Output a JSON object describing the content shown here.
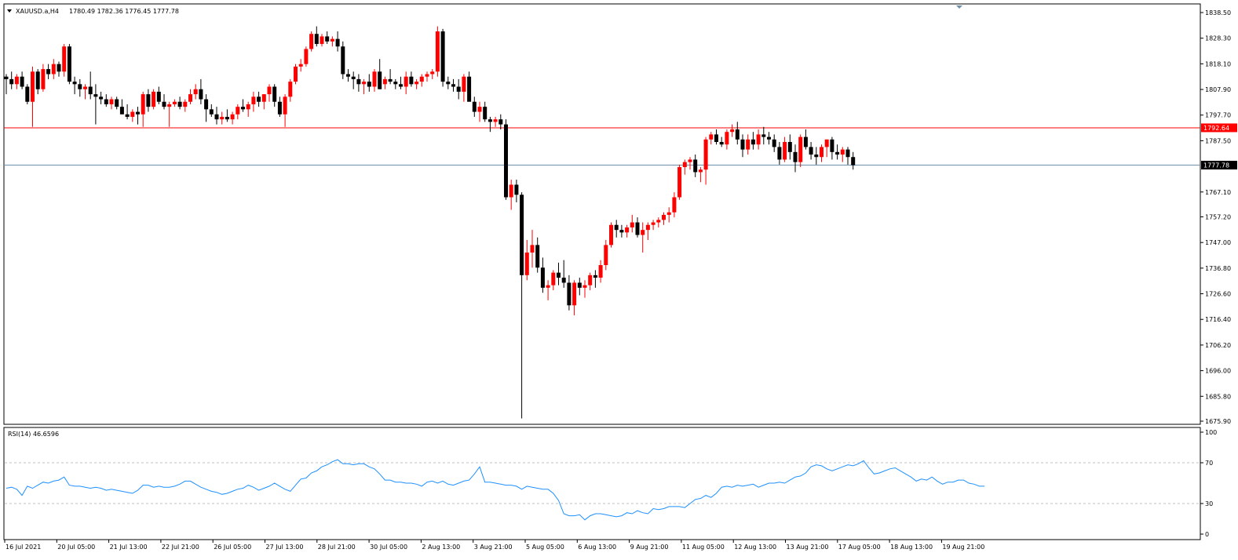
{
  "header": {
    "symbol": "XAUUSD.a,H4",
    "ohlc": "1780.49 1782.36 1776.45 1777.78"
  },
  "rsi_header": "RSI(14) 46.6596",
  "colors": {
    "bull": "#ff0000",
    "bear": "#000000",
    "rsi_line": "#1e90ff",
    "level_line": "#ff0000",
    "price_line": "#6f8fa8",
    "grid_dash": "#c0c0c0"
  },
  "price_axis": {
    "ticks": [
      "1838.50",
      "1828.30",
      "1818.10",
      "1807.90",
      "1797.70",
      "1787.50",
      "1767.10",
      "1757.20",
      "1747.00",
      "1736.80",
      "1726.60",
      "1716.40",
      "1706.20",
      "1696.00",
      "1685.80",
      "1675.90"
    ],
    "level_label": "1792.64",
    "current_label": "1777.78"
  },
  "rsi_axis": {
    "ticks": [
      "100",
      "70",
      "30",
      "0"
    ]
  },
  "time_axis": {
    "ticks": [
      "16 Jul 2021",
      "20 Jul 05:00",
      "21 Jul 13:00",
      "22 Jul 21:00",
      "26 Jul 05:00",
      "27 Jul 13:00",
      "28 Jul 21:00",
      "30 Jul 05:00",
      "2 Aug 13:00",
      "3 Aug 21:00",
      "5 Aug 05:00",
      "6 Aug 13:00",
      "9 Aug 21:00",
      "11 Aug 05:00",
      "12 Aug 13:00",
      "13 Aug 21:00",
      "17 Aug 05:00",
      "18 Aug 13:00",
      "19 Aug 21:00"
    ]
  },
  "chart_data": [
    {
      "type": "candlestick",
      "title": "XAUUSD.a,H4",
      "ylim": [
        1675.9,
        1838.5
      ],
      "levels": {
        "horizontal_line": 1792.64,
        "last_price": 1777.78
      },
      "candles": [
        [
          1813.0,
          1814.0,
          1806.0,
          1812.0
        ],
        [
          1812.0,
          1815.0,
          1808.0,
          1810.0
        ],
        [
          1810.0,
          1814.0,
          1808.0,
          1813.0
        ],
        [
          1813.0,
          1815.0,
          1808.0,
          1809.0
        ],
        [
          1809.0,
          1810.0,
          1802.0,
          1803.0
        ],
        [
          1803.0,
          1817.0,
          1793.0,
          1815.0
        ],
        [
          1815.0,
          1816.0,
          1806.0,
          1808.0
        ],
        [
          1808.0,
          1818.0,
          1807.0,
          1816.0
        ],
        [
          1816.0,
          1818.0,
          1812.0,
          1814.0
        ],
        [
          1814.0,
          1820.0,
          1812.0,
          1818.0
        ],
        [
          1818.0,
          1819.0,
          1813.0,
          1815.0
        ],
        [
          1815.0,
          1826.0,
          1813.0,
          1825.0
        ],
        [
          1825.0,
          1826.0,
          1810.0,
          1811.0
        ],
        [
          1811.0,
          1813.0,
          1806.0,
          1810.0
        ],
        [
          1810.0,
          1812.0,
          1805.0,
          1808.0
        ],
        [
          1808.0,
          1810.0,
          1804.0,
          1809.0
        ],
        [
          1809.0,
          1815.0,
          1804.0,
          1806.0
        ],
        [
          1806.0,
          1810.0,
          1794.0,
          1805.0
        ],
        [
          1805.0,
          1807.0,
          1802.0,
          1804.0
        ],
        [
          1804.0,
          1806.0,
          1801.0,
          1802.0
        ],
        [
          1802.0,
          1805.0,
          1800.0,
          1804.0
        ],
        [
          1804.0,
          1805.0,
          1800.0,
          1801.0
        ],
        [
          1801.0,
          1804.0,
          1800.0,
          1798.0
        ],
        [
          1798.0,
          1802.0,
          1796.0,
          1797.0
        ],
        [
          1797.0,
          1800.0,
          1795.0,
          1799.0
        ],
        [
          1799.0,
          1801.0,
          1794.0,
          1798.0
        ],
        [
          1798.0,
          1807.0,
          1793.0,
          1806.0
        ],
        [
          1806.0,
          1808.0,
          1799.0,
          1801.0
        ],
        [
          1801.0,
          1808.0,
          1800.0,
          1807.0
        ],
        [
          1807.0,
          1809.0,
          1802.0,
          1803.0
        ],
        [
          1803.0,
          1806.0,
          1800.0,
          1801.0
        ],
        [
          1801.0,
          1803.0,
          1793.0,
          1802.0
        ],
        [
          1802.0,
          1804.0,
          1801.0,
          1803.0
        ],
        [
          1803.0,
          1805.0,
          1800.0,
          1801.0
        ],
        [
          1801.0,
          1804.0,
          1799.0,
          1803.0
        ],
        [
          1803.0,
          1808.0,
          1802.0,
          1806.0
        ],
        [
          1806.0,
          1810.0,
          1804.0,
          1808.0
        ],
        [
          1808.0,
          1812.0,
          1802.0,
          1804.0
        ],
        [
          1804.0,
          1806.0,
          1795.0,
          1800.0
        ],
        [
          1800.0,
          1802.0,
          1797.0,
          1798.0
        ],
        [
          1798.0,
          1801.0,
          1794.0,
          1796.0
        ],
        [
          1796.0,
          1799.0,
          1794.0,
          1797.0
        ],
        [
          1797.0,
          1800.0,
          1795.0,
          1796.0
        ],
        [
          1796.0,
          1799.0,
          1794.0,
          1798.0
        ],
        [
          1798.0,
          1802.0,
          1796.0,
          1801.0
        ],
        [
          1801.0,
          1804.0,
          1799.0,
          1800.0
        ],
        [
          1800.0,
          1803.0,
          1797.0,
          1802.0
        ],
        [
          1802.0,
          1807.0,
          1799.0,
          1805.0
        ],
        [
          1805.0,
          1807.0,
          1801.0,
          1803.0
        ],
        [
          1803.0,
          1806.0,
          1800.0,
          1806.0
        ],
        [
          1806.0,
          1810.0,
          1803.0,
          1809.0
        ],
        [
          1809.0,
          1810.0,
          1801.0,
          1803.0
        ],
        [
          1803.0,
          1805.0,
          1797.0,
          1798.0
        ],
        [
          1798.0,
          1806.0,
          1793.0,
          1805.0
        ],
        [
          1805.0,
          1812.0,
          1803.0,
          1811.0
        ],
        [
          1811.0,
          1818.0,
          1810.0,
          1817.0
        ],
        [
          1817.0,
          1820.0,
          1815.0,
          1818.0
        ],
        [
          1818.0,
          1825.0,
          1817.0,
          1824.0
        ],
        [
          1824.0,
          1831.0,
          1823.0,
          1830.0
        ],
        [
          1830.0,
          1833.0,
          1825.0,
          1826.0
        ],
        [
          1826.0,
          1830.0,
          1825.0,
          1829.0
        ],
        [
          1829.0,
          1831.0,
          1826.0,
          1827.0
        ],
        [
          1827.0,
          1829.0,
          1825.0,
          1828.0
        ],
        [
          1828.0,
          1831.0,
          1823.0,
          1825.0
        ],
        [
          1825.0,
          1827.0,
          1812.0,
          1814.0
        ],
        [
          1814.0,
          1816.0,
          1811.0,
          1813.0
        ],
        [
          1813.0,
          1815.0,
          1808.0,
          1812.0
        ],
        [
          1812.0,
          1814.0,
          1807.0,
          1810.0
        ],
        [
          1810.0,
          1812.0,
          1806.0,
          1811.0
        ],
        [
          1811.0,
          1814.0,
          1807.0,
          1809.0
        ],
        [
          1809.0,
          1816.0,
          1807.0,
          1815.0
        ],
        [
          1815.0,
          1820.0,
          1808.0,
          1808.0
        ],
        [
          1810.0,
          1813.0,
          1808.0,
          1812.0
        ],
        [
          1812.0,
          1816.0,
          1810.0,
          1811.0
        ],
        [
          1811.0,
          1812.0,
          1808.0,
          1810.0
        ],
        [
          1810.0,
          1813.0,
          1808.0,
          1809.0
        ],
        [
          1809.0,
          1815.0,
          1806.0,
          1813.0
        ],
        [
          1813.0,
          1815.0,
          1809.0,
          1810.0
        ],
        [
          1810.0,
          1812.0,
          1808.0,
          1811.0
        ],
        [
          1811.0,
          1814.0,
          1809.0,
          1813.0
        ],
        [
          1813.0,
          1815.0,
          1811.0,
          1814.0
        ],
        [
          1814.0,
          1816.0,
          1812.0,
          1815.0
        ],
        [
          1815.0,
          1833.0,
          1813.0,
          1831.0
        ],
        [
          1831.0,
          1832.0,
          1809.0,
          1811.0
        ],
        [
          1811.0,
          1813.0,
          1808.0,
          1810.0
        ],
        [
          1810.0,
          1812.0,
          1807.0,
          1809.0
        ],
        [
          1809.0,
          1812.0,
          1804.0,
          1807.0
        ],
        [
          1807.0,
          1814.0,
          1803.0,
          1813.0
        ],
        [
          1813.0,
          1815.0,
          1807.0,
          1803.0
        ],
        [
          1803.0,
          1805.0,
          1797.0,
          1799.0
        ],
        [
          1799.0,
          1803.0,
          1795.0,
          1801.0
        ],
        [
          1801.0,
          1803.0,
          1795.0,
          1796.0
        ],
        [
          1796.0,
          1797.0,
          1791.0,
          1795.0
        ],
        [
          1795.0,
          1797.0,
          1793.0,
          1796.0
        ],
        [
          1796.0,
          1798.0,
          1792.0,
          1794.0
        ],
        [
          1794.0,
          1796.0,
          1764.0,
          1765.0
        ],
        [
          1765.0,
          1772.0,
          1760.0,
          1770.0
        ],
        [
          1770.0,
          1772.0,
          1763.0,
          1766.0
        ],
        [
          1766.0,
          1767.0,
          1677.0,
          1734.0
        ],
        [
          1734.0,
          1748.0,
          1732.0,
          1743.0
        ],
        [
          1743.0,
          1752.0,
          1737.0,
          1746.0
        ],
        [
          1746.0,
          1749.0,
          1735.0,
          1737.0
        ],
        [
          1737.0,
          1741.0,
          1727.0,
          1729.0
        ],
        [
          1729.0,
          1732.0,
          1724.0,
          1730.0
        ],
        [
          1730.0,
          1736.0,
          1728.0,
          1735.0
        ],
        [
          1735.0,
          1739.0,
          1730.0,
          1733.0
        ],
        [
          1733.0,
          1740.0,
          1729.0,
          1731.0
        ],
        [
          1731.0,
          1734.0,
          1720.0,
          1722.0
        ],
        [
          1722.0,
          1732.0,
          1718.0,
          1731.0
        ],
        [
          1731.0,
          1733.0,
          1726.0,
          1729.0
        ],
        [
          1729.0,
          1732.0,
          1725.0,
          1730.0
        ],
        [
          1730.0,
          1735.0,
          1728.0,
          1734.0
        ],
        [
          1734.0,
          1736.0,
          1729.0,
          1733.0
        ],
        [
          1733.0,
          1740.0,
          1731.0,
          1738.0
        ],
        [
          1738.0,
          1748.0,
          1736.0,
          1746.0
        ],
        [
          1746.0,
          1755.0,
          1745.0,
          1754.0
        ],
        [
          1754.0,
          1756.0,
          1749.0,
          1752.0
        ],
        [
          1752.0,
          1754.0,
          1749.0,
          1751.0
        ],
        [
          1751.0,
          1754.0,
          1749.0,
          1753.0
        ],
        [
          1753.0,
          1758.0,
          1751.0,
          1755.0
        ],
        [
          1755.0,
          1757.0,
          1749.0,
          1750.0
        ],
        [
          1750.0,
          1755.0,
          1743.0,
          1752.0
        ],
        [
          1752.0,
          1755.0,
          1748.0,
          1754.0
        ],
        [
          1754.0,
          1756.0,
          1752.0,
          1755.0
        ],
        [
          1755.0,
          1757.0,
          1753.0,
          1756.0
        ],
        [
          1756.0,
          1759.0,
          1754.0,
          1758.0
        ],
        [
          1758.0,
          1761.0,
          1755.0,
          1759.0
        ],
        [
          1759.0,
          1767.0,
          1757.0,
          1765.0
        ],
        [
          1765.0,
          1778.0,
          1764.0,
          1777.0
        ],
        [
          1777.0,
          1780.0,
          1774.0,
          1779.0
        ],
        [
          1779.0,
          1781.0,
          1776.0,
          1780.0
        ],
        [
          1780.0,
          1782.0,
          1773.0,
          1775.0
        ],
        [
          1775.0,
          1777.0,
          1771.0,
          1776.0
        ],
        [
          1776.0,
          1789.0,
          1770.0,
          1788.0
        ],
        [
          1788.0,
          1791.0,
          1786.0,
          1790.0
        ],
        [
          1790.0,
          1792.0,
          1786.0,
          1787.0
        ],
        [
          1787.0,
          1789.0,
          1785.0,
          1786.0
        ],
        [
          1786.0,
          1792.0,
          1784.0,
          1791.0
        ],
        [
          1791.0,
          1794.0,
          1789.0,
          1792.0
        ],
        [
          1792.0,
          1795.0,
          1786.0,
          1788.0
        ],
        [
          1788.0,
          1790.0,
          1781.0,
          1784.0
        ],
        [
          1784.0,
          1790.0,
          1782.0,
          1788.0
        ],
        [
          1788.0,
          1791.0,
          1784.0,
          1786.0
        ],
        [
          1786.0,
          1792.0,
          1784.0,
          1790.0
        ],
        [
          1790.0,
          1793.0,
          1786.0,
          1789.0
        ],
        [
          1789.0,
          1791.0,
          1786.0,
          1788.0
        ],
        [
          1788.0,
          1790.0,
          1783.0,
          1785.0
        ],
        [
          1785.0,
          1787.0,
          1778.0,
          1780.0
        ],
        [
          1780.0,
          1789.0,
          1779.0,
          1787.0
        ],
        [
          1787.0,
          1790.0,
          1780.0,
          1783.0
        ],
        [
          1783.0,
          1786.0,
          1775.0,
          1779.0
        ],
        [
          1779.0,
          1790.0,
          1777.0,
          1789.0
        ],
        [
          1789.0,
          1792.0,
          1784.0,
          1785.0
        ],
        [
          1785.0,
          1787.0,
          1780.0,
          1782.0
        ],
        [
          1782.0,
          1785.0,
          1778.0,
          1781.0
        ],
        [
          1781.0,
          1786.0,
          1779.0,
          1785.0
        ],
        [
          1785.0,
          1788.0,
          1781.0,
          1788.0
        ],
        [
          1788.0,
          1789.0,
          1780.0,
          1783.0
        ],
        [
          1783.0,
          1786.0,
          1780.0,
          1782.0
        ],
        [
          1782.0,
          1785.0,
          1779.0,
          1784.0
        ],
        [
          1784.0,
          1785.0,
          1778.0,
          1781.0
        ],
        [
          1781.0,
          1783.0,
          1776.0,
          1777.78
        ]
      ]
    },
    {
      "type": "line",
      "title": "RSI(14) 46.6596",
      "ylim": [
        0,
        100
      ],
      "levels": [
        70,
        30
      ],
      "values": [
        45,
        46,
        44,
        38,
        47,
        45,
        48,
        51,
        50,
        52,
        53,
        56,
        48,
        47,
        47,
        46,
        45,
        46,
        45,
        43,
        44,
        43,
        42,
        41,
        40,
        43,
        48,
        48,
        46,
        47,
        46,
        46,
        47,
        49,
        52,
        52,
        49,
        46,
        44,
        42,
        41,
        39,
        40,
        42,
        44,
        45,
        48,
        46,
        43,
        45,
        47,
        50,
        47,
        44,
        42,
        48,
        54,
        55,
        60,
        62,
        66,
        68,
        71,
        73,
        69,
        69,
        68,
        69,
        69,
        66,
        64,
        59,
        53,
        53,
        51,
        51,
        50,
        50,
        49,
        47,
        51,
        52,
        50,
        52,
        49,
        48,
        50,
        52,
        53,
        59,
        66,
        51,
        51,
        50,
        49,
        48,
        48,
        47,
        44,
        47,
        46,
        45,
        44,
        44,
        40,
        33,
        20,
        18,
        18,
        19,
        14,
        18,
        20,
        20,
        19,
        18,
        17,
        18,
        21,
        20,
        23,
        21,
        20,
        25,
        24,
        25,
        27,
        27,
        27,
        26,
        30,
        34,
        35,
        38,
        36,
        40,
        46,
        47,
        46,
        48,
        47,
        48,
        49,
        46,
        48,
        50,
        50,
        51,
        50,
        53,
        56,
        57,
        60,
        66,
        68,
        67,
        64,
        62,
        64,
        66,
        68,
        67,
        69,
        72,
        65,
        59,
        60,
        62,
        64,
        65,
        62,
        59,
        56,
        52,
        54,
        53,
        56,
        52,
        49,
        51,
        51,
        53,
        53,
        50,
        49,
        47,
        47
      ]
    }
  ]
}
